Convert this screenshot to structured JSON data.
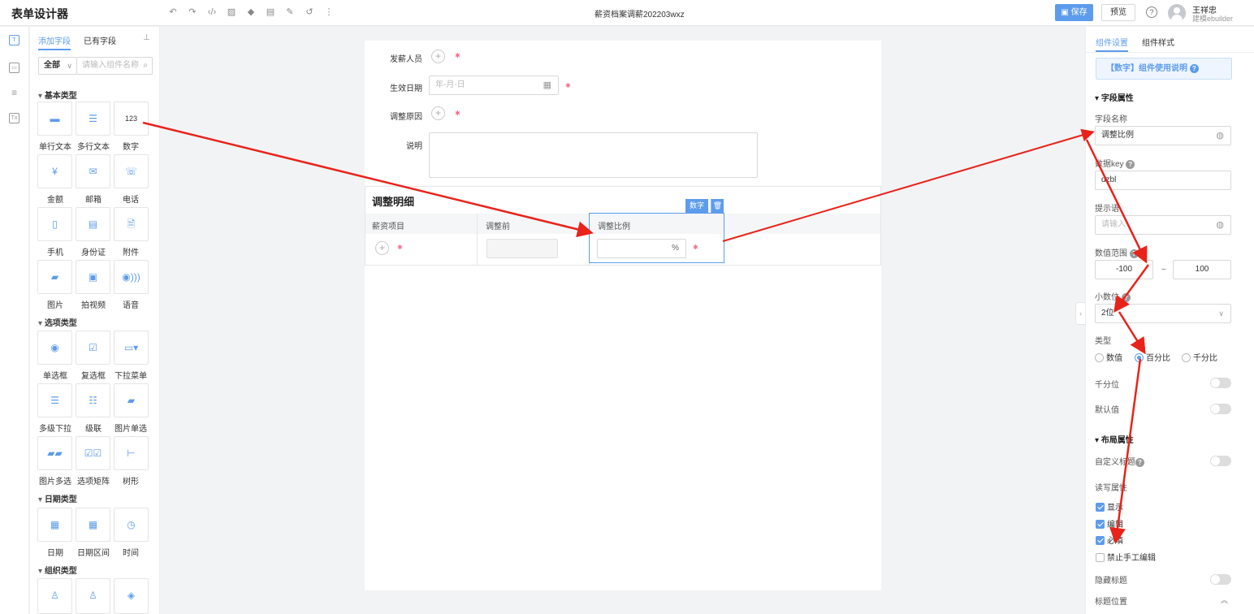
{
  "header": {
    "title": "表单设计器",
    "doc_title": "薪资档案调薪202203wxz",
    "save_label": "保存",
    "preview_label": "预览",
    "user_name": "王祥忠",
    "user_company": "建模ebuilder",
    "toolbar_icons": [
      "undo-icon",
      "redo-icon",
      "code-icon",
      "image-icon",
      "layers-icon",
      "save-template-icon",
      "edit-icon",
      "history-icon",
      "more-icon"
    ]
  },
  "left_panel": {
    "tabs": [
      "添加字段",
      "已有字段"
    ],
    "filter_value": "全部",
    "search_placeholder": "请输入组件名称",
    "categories": [
      "基本类型",
      "选项类型",
      "日期类型",
      "组织类型"
    ],
    "basic": [
      "单行文本",
      "多行文本",
      "数字",
      "金额",
      "邮箱",
      "电话",
      "手机",
      "身份证",
      "附件",
      "图片",
      "拍视频",
      "语音"
    ],
    "options": [
      "单选框",
      "复选框",
      "下拉菜单",
      "多级下拉",
      "级联",
      "图片单选",
      "图片多选",
      "选项矩阵",
      "树形"
    ],
    "dates": [
      "日期",
      "日期区间",
      "时间"
    ],
    "number_glyph": "123"
  },
  "canvas": {
    "fields": {
      "payer": "发薪人员",
      "effective_date": "生效日期",
      "date_placeholder": "年-月-日",
      "reason": "调整原因",
      "note": "说明"
    },
    "detail": {
      "title": "调整明细",
      "columns": [
        "薪资项目",
        "调整前",
        "调整比例"
      ],
      "percent_suffix": "%",
      "selected_badge": "数字"
    }
  },
  "right_panel": {
    "tabs": [
      "组件设置",
      "组件样式"
    ],
    "usage_label": "【数字】组件使用说明",
    "field_props": "字段属性",
    "field_name_label": "字段名称",
    "field_name_value": "调整比例",
    "data_key_label": "数据key",
    "data_key_value": "dzbl",
    "hint_label": "提示语",
    "hint_placeholder": "请输入",
    "range_label": "数值范围",
    "range_min": "-100",
    "range_sep": "~",
    "range_max": "100",
    "decimal_label": "小数位",
    "decimal_value": "2位",
    "type_label": "类型",
    "types": [
      "数值",
      "百分比",
      "千分比"
    ],
    "thousands_label": "千分位",
    "default_label": "默认值",
    "layout_props": "布局属性",
    "custom_title_label": "自定义标题",
    "rw_label": "读写属性",
    "rw_options": [
      {
        "label": "显示",
        "checked": true
      },
      {
        "label": "编辑",
        "checked": true
      },
      {
        "label": "必填",
        "checked": true
      },
      {
        "label": "禁止手工编辑",
        "checked": false
      }
    ],
    "hide_title_label": "隐藏标题",
    "title_pos_label": "标题位置"
  },
  "colors": {
    "accent": "#5d9cec",
    "required": "#f56c8c",
    "arrow": "#e8231a"
  }
}
